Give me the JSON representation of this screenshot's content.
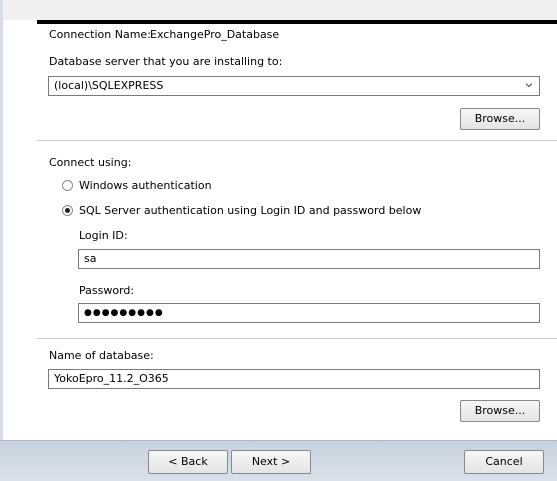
{
  "connection": {
    "name_label": "Connection Name:",
    "name_value": "ExchangePro_Database"
  },
  "server": {
    "label": "Database server that you are installing to:",
    "value": "(local)\\SQLEXPRESS",
    "browse_label": "Browse..."
  },
  "auth": {
    "section_label": "Connect using:",
    "options": [
      {
        "label": "Windows authentication",
        "selected": false
      },
      {
        "label": "SQL Server authentication using Login ID and password below",
        "selected": true
      }
    ],
    "login_label": "Login ID:",
    "login_value": "sa",
    "password_label": "Password:",
    "password_value": "●●●●●●●●●"
  },
  "database": {
    "label": "Name of database:",
    "value": "YokoEpro_11.2_O365",
    "browse_label": "Browse..."
  },
  "footer": {
    "back_label": "< Back",
    "next_label": "Next >",
    "cancel_label": "Cancel"
  }
}
